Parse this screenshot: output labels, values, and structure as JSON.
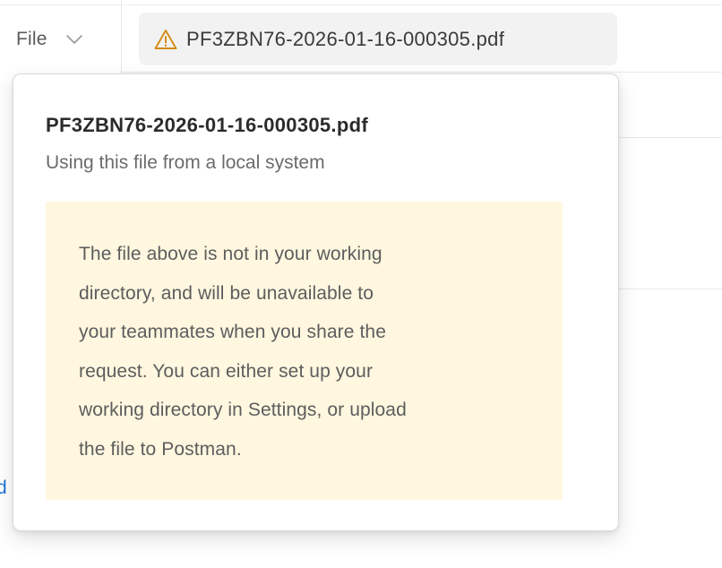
{
  "request": {
    "body_type_selector": {
      "label": "File",
      "icon": "chevron-down-icon"
    },
    "file_chip": {
      "icon": "warning-icon",
      "filename": "PF3ZBN76-2026-01-16-000305.pdf"
    },
    "partial_text": "d"
  },
  "popover": {
    "title": "PF3ZBN76-2026-01-16-000305.pdf",
    "subtitle": "Using this file from a local system",
    "warning": {
      "lines": [
        "The file above is not in your working",
        "directory, and will be unavailable to",
        "your teammates when you share the",
        "request. You can either set up your",
        "working directory in Settings, or upload",
        "the file to Postman."
      ]
    }
  },
  "colors": {
    "warning_background": "#fff7e0",
    "warning_icon": "#d28a16",
    "chip_background": "#f2f2f2",
    "link": "#1a6fd6"
  }
}
